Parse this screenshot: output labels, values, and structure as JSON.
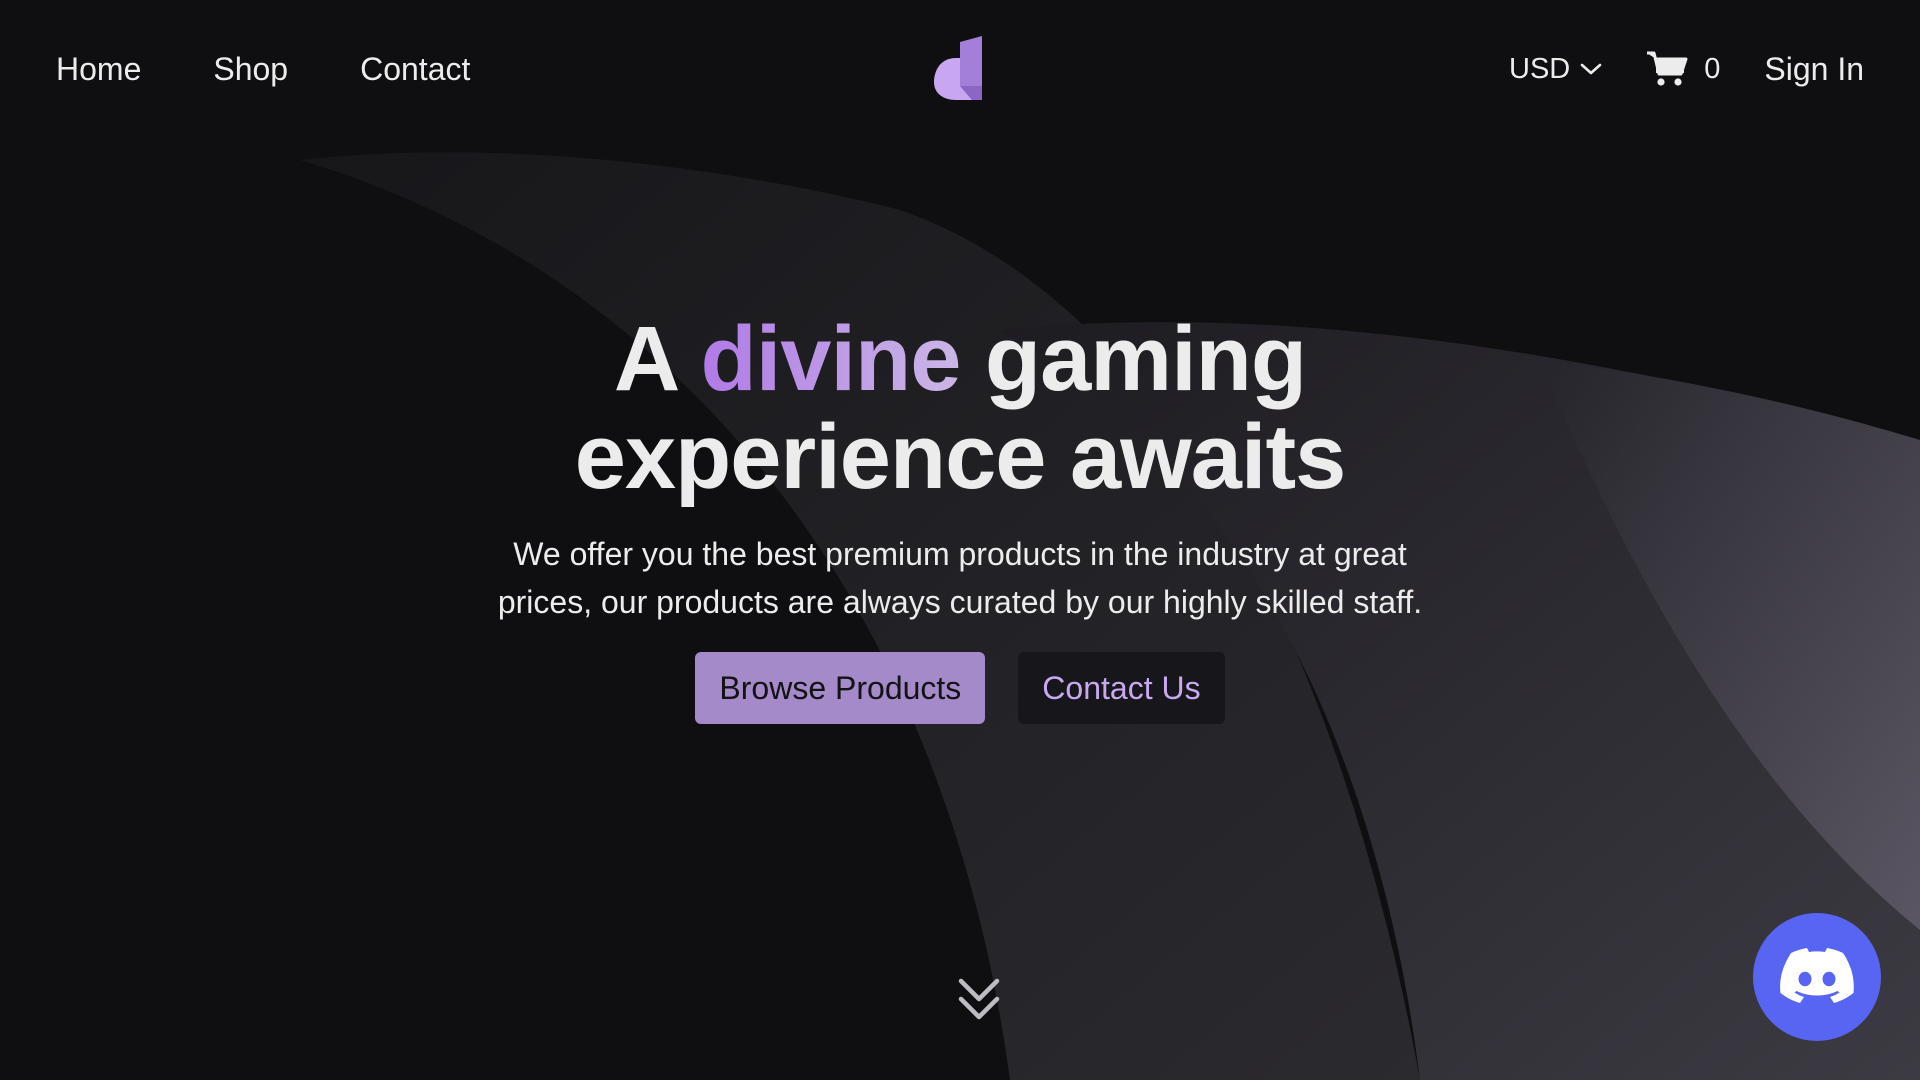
{
  "nav": {
    "links": [
      {
        "label": "Home"
      },
      {
        "label": "Shop"
      },
      {
        "label": "Contact"
      }
    ],
    "logo_icon": "brand-logo-icon",
    "currency": {
      "value": "USD",
      "icon": "chevron-down-icon"
    },
    "cart": {
      "icon": "cart-icon",
      "count": "0"
    },
    "sign_in": "Sign In"
  },
  "hero": {
    "title_prefix": "A ",
    "title_accent": "divine",
    "title_suffix": " gaming",
    "title_line2": "experience awaits",
    "subtitle_line1": "We offer you the best premium products in the industry at great",
    "subtitle_line2": "prices, our products are always curated by our highly skilled staff.",
    "primary_button": "Browse Products",
    "secondary_button": "Contact Us",
    "scroll_icon": "double-chevron-down-icon"
  },
  "discord": {
    "icon": "discord-icon"
  },
  "colors": {
    "background": "#0f0f11",
    "accent": "#b88ddf",
    "primary_button": "#a48ac8",
    "discord": "#5865f2"
  }
}
